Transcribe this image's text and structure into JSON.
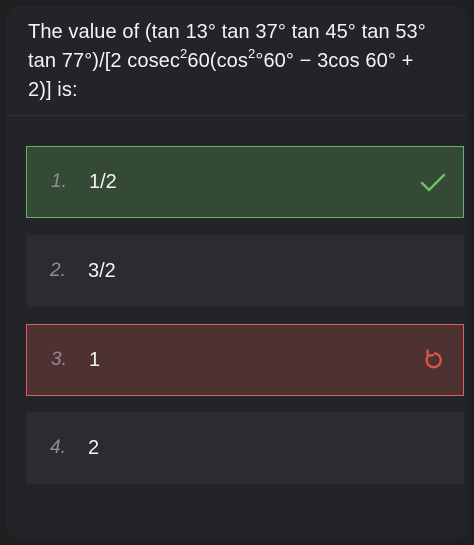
{
  "question": {
    "line1": "The value of (tan 13° tan 37° tan 45° tan 53°",
    "line2_a": "tan 77°)/[2 cosec",
    "line2_sup1": "2",
    "line2_b": "60(cos",
    "line2_sup2": "2",
    "line2_c": "°60° − 3cos 60° +",
    "line3": "2)] is:"
  },
  "options": [
    {
      "number": "1.",
      "text": "1/2",
      "status": "correct",
      "icon": "checkmark-icon"
    },
    {
      "number": "2.",
      "text": "3/2",
      "status": "neutral",
      "icon": ""
    },
    {
      "number": "3.",
      "text": "1",
      "status": "wrong",
      "icon": "retry-icon"
    },
    {
      "number": "4.",
      "text": "2",
      "status": "neutral",
      "icon": ""
    }
  ],
  "colors": {
    "background": "#232427",
    "option_bg": "#2b2c2f",
    "correct_bg": "#344a35",
    "correct_border": "#6bb06c",
    "wrong_bg": "#4e3131",
    "wrong_border": "#d9605e"
  }
}
